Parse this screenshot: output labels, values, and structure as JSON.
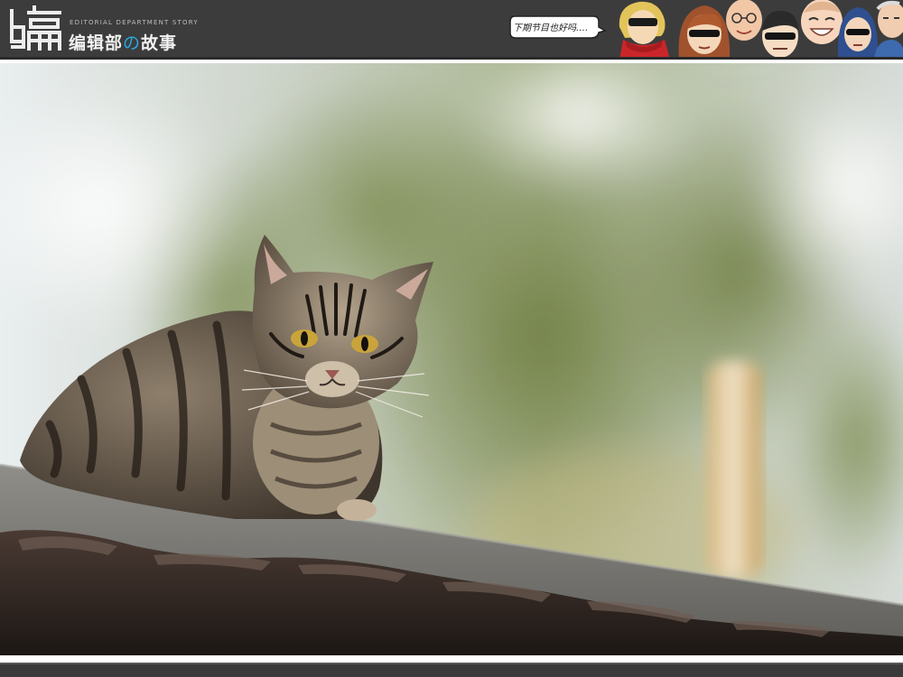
{
  "header": {
    "logo_text": "编",
    "brand_subtitle": "EDITORIAL DEPARTMENT STORY",
    "brand_name_prefix": "编辑部",
    "brand_name_no": "の",
    "brand_name_suffix": "故事",
    "bubble_text": "下期节目也好吗……",
    "characters": [
      "character-blonde-sunglasses",
      "character-redhead-sunglasses",
      "character-bald-glasses",
      "character-dark-hair-glasses",
      "character-smiling-round-face",
      "character-blue-hair-sunglasses",
      "character-old-man"
    ]
  },
  "photo": {
    "subject": "cat-on-roof-photo"
  },
  "colors": {
    "header_bg": "#3c3c3c",
    "accent_blue": "#29a8e0",
    "footer_bg": "#3a3a3a"
  }
}
